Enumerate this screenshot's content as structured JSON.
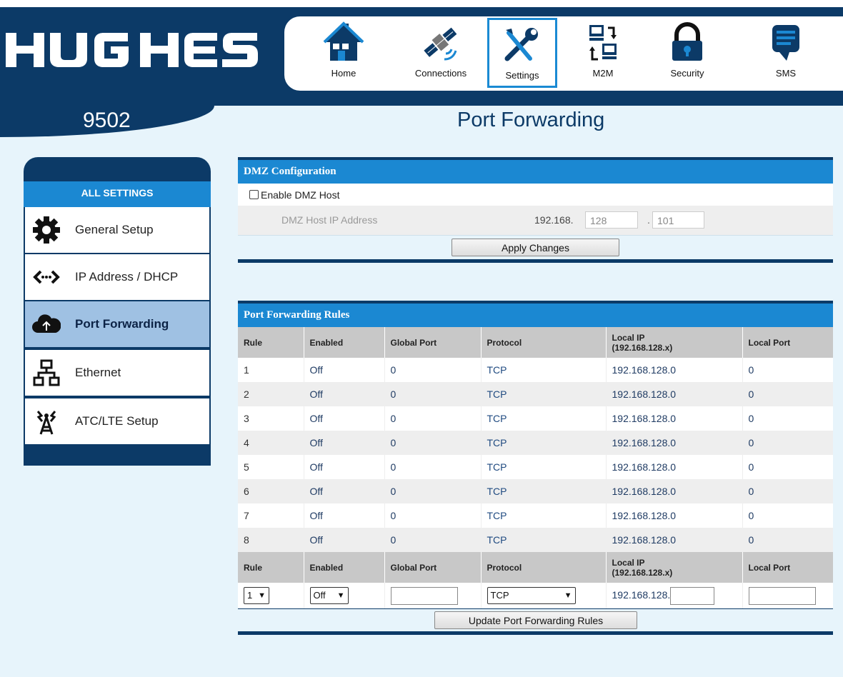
{
  "brand": {
    "logo_text": "HUGHES",
    "model": "9502",
    "navy": "#0c3a67",
    "accent": "#1b88d2"
  },
  "nav": [
    {
      "label": "Home",
      "icon": "house-icon"
    },
    {
      "label": "Connections",
      "icon": "satellite-icon"
    },
    {
      "label": "Settings",
      "icon": "tools-icon",
      "active": true
    },
    {
      "label": "M2M",
      "icon": "computers-icon"
    },
    {
      "label": "Security",
      "icon": "lock-icon"
    },
    {
      "label": "SMS",
      "icon": "chat-icon"
    }
  ],
  "page_title": "Port Forwarding",
  "sidebar": {
    "heading": "ALL SETTINGS",
    "items": [
      {
        "label": "General Setup",
        "icon": "gear-icon"
      },
      {
        "label": "IP Address / DHCP",
        "icon": "code-arrows-icon"
      },
      {
        "label": "Port Forwarding",
        "icon": "cloud-icon",
        "active": true
      },
      {
        "label": "Ethernet",
        "icon": "network-icon"
      },
      {
        "label": "ATC/LTE Setup",
        "icon": "antenna-tower-icon"
      }
    ]
  },
  "dmz": {
    "title": "DMZ Configuration",
    "enable_label": "Enable DMZ Host",
    "enabled": false,
    "host_ip_label": "DMZ Host IP Address",
    "ip_prefix": "192.168.",
    "octet3": "128",
    "separator": ".",
    "octet4": "101",
    "apply_label": "Apply Changes"
  },
  "pf": {
    "title": "Port Forwarding Rules",
    "headers": {
      "rule": "Rule",
      "enabled": "Enabled",
      "global_port": "Global Port",
      "protocol": "Protocol",
      "local_ip_line1": "Local IP",
      "local_ip_line2": "(192.168.128.x)",
      "local_port": "Local Port"
    },
    "rows": [
      {
        "rule": "1",
        "enabled": "Off",
        "global_port": "0",
        "protocol": "TCP",
        "local_ip": "192.168.128.0",
        "local_port": "0"
      },
      {
        "rule": "2",
        "enabled": "Off",
        "global_port": "0",
        "protocol": "TCP",
        "local_ip": "192.168.128.0",
        "local_port": "0"
      },
      {
        "rule": "3",
        "enabled": "Off",
        "global_port": "0",
        "protocol": "TCP",
        "local_ip": "192.168.128.0",
        "local_port": "0"
      },
      {
        "rule": "4",
        "enabled": "Off",
        "global_port": "0",
        "protocol": "TCP",
        "local_ip": "192.168.128.0",
        "local_port": "0"
      },
      {
        "rule": "5",
        "enabled": "Off",
        "global_port": "0",
        "protocol": "TCP",
        "local_ip": "192.168.128.0",
        "local_port": "0"
      },
      {
        "rule": "6",
        "enabled": "Off",
        "global_port": "0",
        "protocol": "TCP",
        "local_ip": "192.168.128.0",
        "local_port": "0"
      },
      {
        "rule": "7",
        "enabled": "Off",
        "global_port": "0",
        "protocol": "TCP",
        "local_ip": "192.168.128.0",
        "local_port": "0"
      },
      {
        "rule": "8",
        "enabled": "Off",
        "global_port": "0",
        "protocol": "TCP",
        "local_ip": "192.168.128.0",
        "local_port": "0"
      }
    ],
    "edit": {
      "rule": "1",
      "enabled": "Off",
      "protocol": "TCP",
      "ip_prefix": "192.168.128."
    },
    "update_label": "Update Port Forwarding Rules"
  }
}
